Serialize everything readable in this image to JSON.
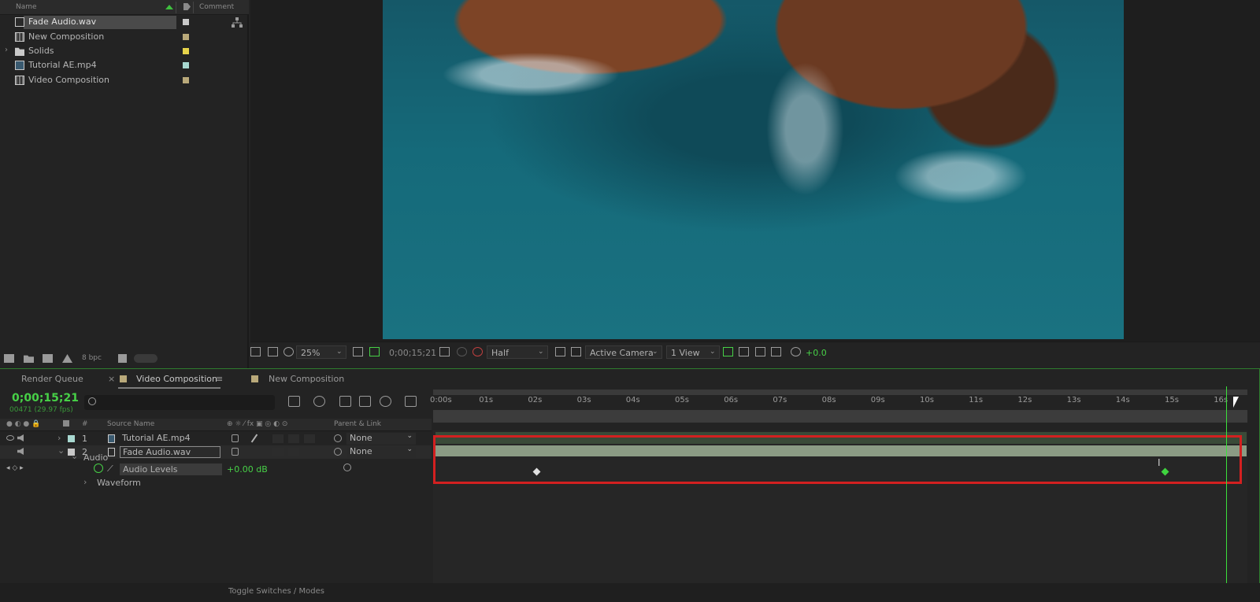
{
  "project": {
    "headers": {
      "name": "Name",
      "comment": "Comment"
    },
    "items": [
      {
        "label": "Fade Audio.wav",
        "icon": "audio-file-icon",
        "color": "#c8c8c8",
        "selected": true
      },
      {
        "label": "New Composition",
        "icon": "composition-icon",
        "color": "#b9a97a"
      },
      {
        "label": "Solids",
        "icon": "folder-icon",
        "color": "#e6d34a"
      },
      {
        "label": "Tutorial AE.mp4",
        "icon": "video-file-icon",
        "color": "#a8d8d0"
      },
      {
        "label": "Video Composition",
        "icon": "composition-icon",
        "color": "#b9a97a"
      }
    ],
    "bpc": "8 bpc"
  },
  "viewer": {
    "zoom": "25%",
    "timecode": "0;00;15;21",
    "resolution": "Half",
    "camera": "Active Camera",
    "views": "1 View",
    "exposure": "+0.0"
  },
  "timeline": {
    "tabs": {
      "render_queue": "Render Queue",
      "video_composition": "Video Composition",
      "new_composition": "New Composition"
    },
    "timecode": "0;00;15;21",
    "frames": "00471 (29.97 fps)",
    "columns": {
      "num": "#",
      "source_name": "Source Name",
      "parent_link": "Parent & Link"
    },
    "layers": [
      {
        "num": "1",
        "name": "Tutorial AE.mp4",
        "parent": "None",
        "color": "#a8d8d0"
      },
      {
        "num": "2",
        "name": "Fade Audio.wav",
        "parent": "None",
        "color": "#c8c8c8"
      }
    ],
    "props": {
      "audio": "Audio",
      "audio_levels": "Audio Levels",
      "audio_levels_value": "+0.00 dB",
      "waveform": "Waveform"
    },
    "ruler_ticks": [
      "0:00s",
      "01s",
      "02s",
      "03s",
      "04s",
      "05s",
      "06s",
      "07s",
      "08s",
      "09s",
      "10s",
      "11s",
      "12s",
      "13s",
      "14s",
      "15s",
      "16s"
    ],
    "footer": {
      "toggle": "Toggle Switches / Modes"
    },
    "accent_color": "#47d147",
    "highlight_color": "#d32020"
  }
}
